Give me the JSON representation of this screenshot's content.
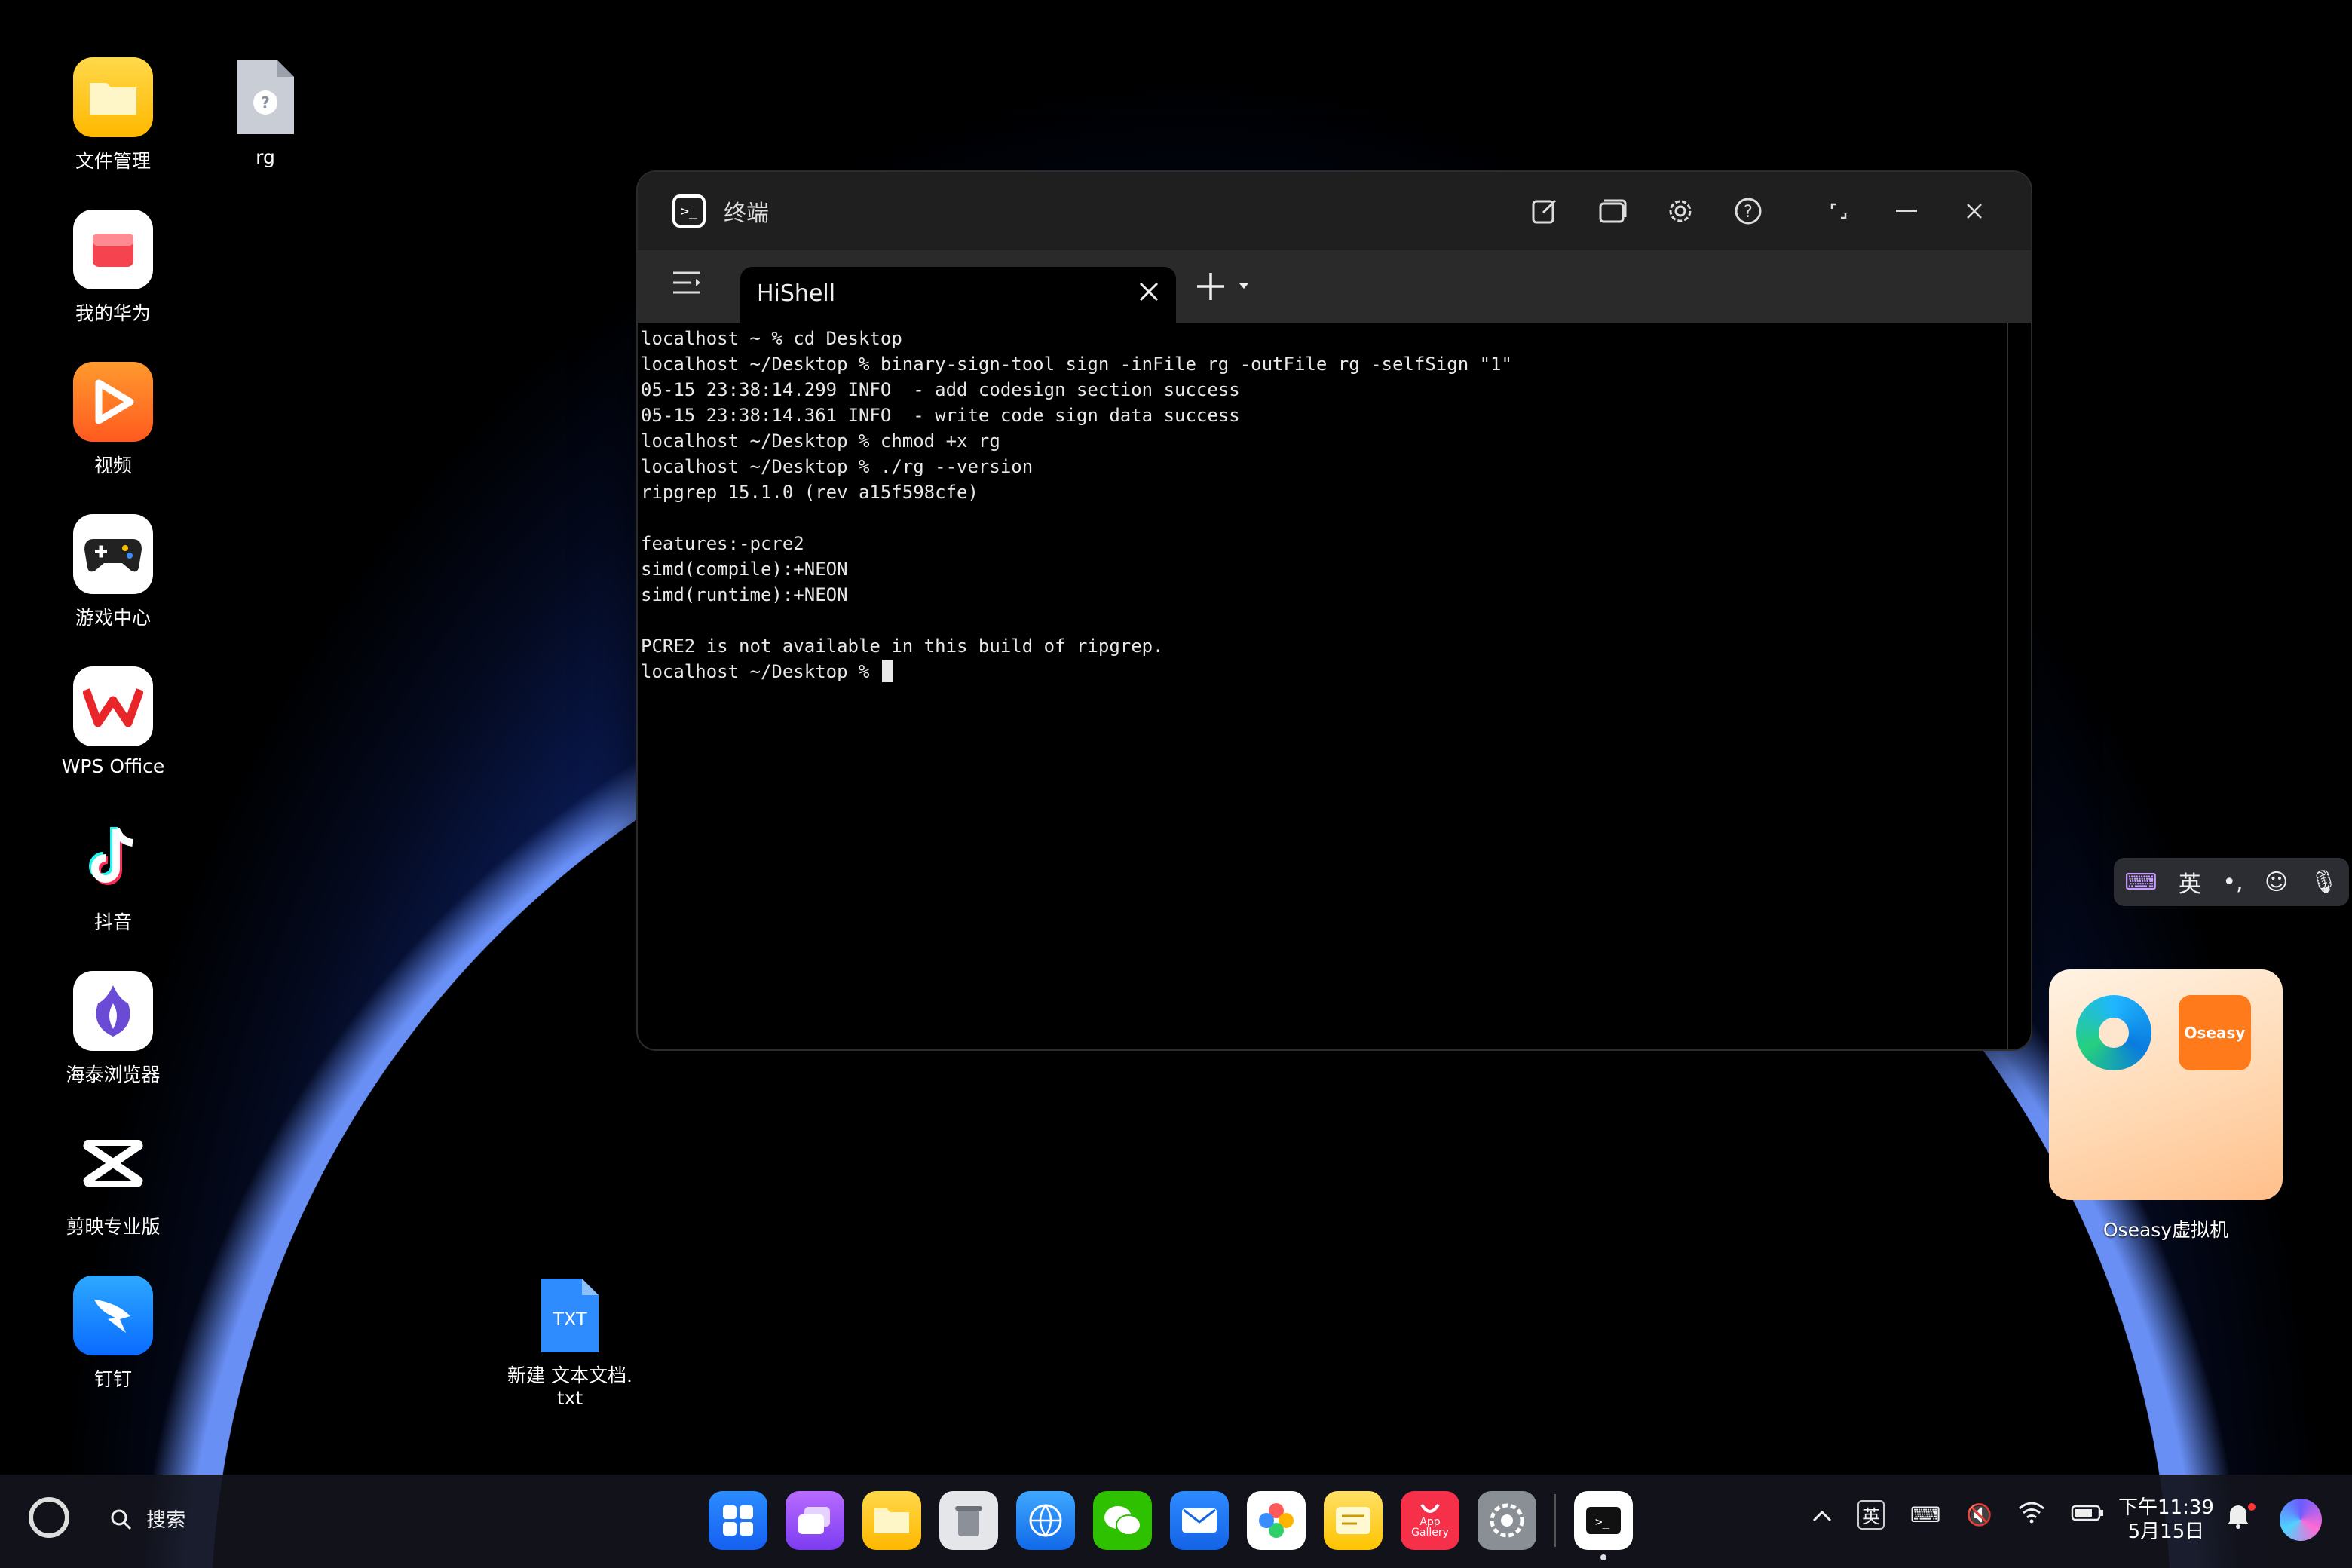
{
  "desktop": {
    "icons": [
      {
        "label": "文件管理",
        "icon": "folder-icon"
      },
      {
        "label": "rg",
        "icon": "unknown-file-icon"
      },
      {
        "label": "我的华为",
        "icon": "huawei-app-icon"
      },
      {
        "label": "视频",
        "icon": "video-icon"
      },
      {
        "label": "游戏中心",
        "icon": "gamepad-icon"
      },
      {
        "label": "WPS Office",
        "icon": "wps-icon"
      },
      {
        "label": "抖音",
        "icon": "tiktok-icon"
      },
      {
        "label": "海泰浏览器",
        "icon": "browser-icon"
      },
      {
        "label": "剪映专业版",
        "icon": "capcut-icon"
      },
      {
        "label": "钉钉",
        "icon": "dingtalk-icon"
      },
      {
        "label": "新建 文本文档.\ntxt",
        "icon": "txt-file-icon"
      }
    ],
    "txt_badge": "TXT",
    "widget": {
      "label": "Oseasy虚拟机",
      "app_text": "Oseasy"
    }
  },
  "terminal": {
    "title": "终端",
    "tab": {
      "name": "HiShell"
    },
    "lines": [
      "localhost ~ % cd Desktop",
      "localhost ~/Desktop % binary-sign-tool sign -inFile rg -outFile rg -selfSign \"1\"",
      "05-15 23:38:14.299 INFO  - add codesign section success",
      "05-15 23:38:14.361 INFO  - write code sign data success",
      "localhost ~/Desktop % chmod +x rg",
      "localhost ~/Desktop % ./rg --version",
      "ripgrep 15.1.0 (rev a15f598cfe)",
      "",
      "features:-pcre2",
      "simd(compile):+NEON",
      "simd(runtime):+NEON",
      "",
      "PCRE2 is not available in this build of ripgrep.",
      "localhost ~/Desktop % "
    ]
  },
  "ime": {
    "lang": "英"
  },
  "taskbar": {
    "search_label": "搜索",
    "dock_app_gallery_label": "App Gallery",
    "input_lang": "英",
    "time": "下午11:39",
    "date": "5月15日"
  },
  "colors": {
    "accent": "#1e6bff",
    "terminal_bg": "#000000",
    "titlebar": "#1f1f1f"
  }
}
